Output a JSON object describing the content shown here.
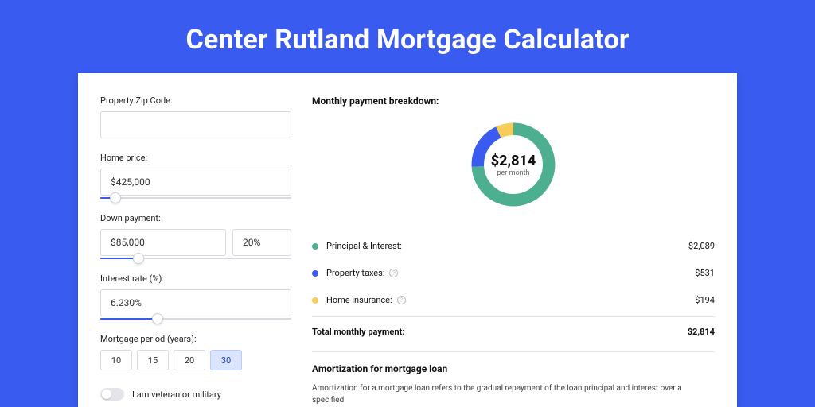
{
  "title": "Center Rutland Mortgage Calculator",
  "form": {
    "zip": {
      "label": "Property Zip Code:",
      "value": ""
    },
    "home_price": {
      "label": "Home price:",
      "value": "$425,000",
      "slider_pct": 8
    },
    "down_payment": {
      "label": "Down payment:",
      "value": "$85,000",
      "percent": "20%",
      "slider_pct": 20
    },
    "interest": {
      "label": "Interest rate (%):",
      "value": "6.230%",
      "slider_pct": 30
    },
    "period": {
      "label": "Mortgage period (years):",
      "options": [
        "10",
        "15",
        "20",
        "30"
      ],
      "selected": "30"
    },
    "veteran_label": "I am veteran or military"
  },
  "breakdown": {
    "title": "Monthly payment breakdown:",
    "total": "$2,814",
    "per": "per month",
    "items": [
      {
        "label": "Principal & Interest:",
        "value": "$2,089",
        "color": "#4CAF8F",
        "info": false,
        "pct": 74
      },
      {
        "label": "Property taxes:",
        "value": "$531",
        "color": "#3A5BEF",
        "info": true,
        "pct": 19
      },
      {
        "label": "Home insurance:",
        "value": "$194",
        "color": "#F6CC5A",
        "info": true,
        "pct": 7
      }
    ],
    "total_label": "Total monthly payment:",
    "total_value": "$2,814"
  },
  "amort": {
    "title": "Amortization for mortgage loan",
    "text": "Amortization for a mortgage loan refers to the gradual repayment of the loan principal and interest over a specified"
  },
  "chart_data": {
    "type": "pie",
    "title": "Monthly payment breakdown",
    "categories": [
      "Principal & Interest",
      "Property taxes",
      "Home insurance"
    ],
    "values": [
      2089,
      531,
      194
    ],
    "total": 2814,
    "colors": [
      "#4CAF8F",
      "#3A5BEF",
      "#F6CC5A"
    ]
  }
}
